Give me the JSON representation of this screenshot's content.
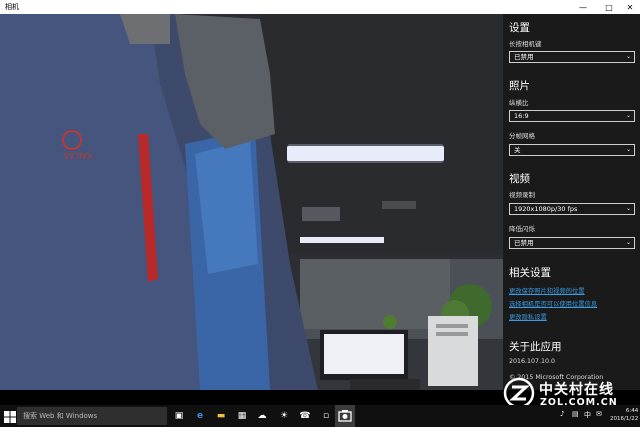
{
  "window": {
    "title": "相机",
    "min_icon": "minimize-icon",
    "max_icon": "maximize-icon",
    "close_icon": "close-icon"
  },
  "settings": {
    "heading": "设置",
    "shutter_label": "长按相机键",
    "shutter_value": "已禁用"
  },
  "photo": {
    "heading": "照片",
    "aspect_label": "纵横比",
    "aspect_value": "16:9",
    "grid_label": "分帧网格",
    "grid_value": "关"
  },
  "video": {
    "heading": "视频",
    "record_label": "视频录制",
    "record_value": "1920x1080p/30 fps",
    "flicker_label": "降低闪烁",
    "flicker_value": "已禁用"
  },
  "related": {
    "heading": "相关设置",
    "link1": "更改保存照片和视频的位置",
    "link2": "选择相机是否可以使用位置信息",
    "link3": "更改隐私设置"
  },
  "about": {
    "heading": "关于此应用",
    "version": "2016.107.10.0",
    "copyright": "© 2015 Microsoft Corporation"
  },
  "taskbar": {
    "search_placeholder": "搜索 Web 和 Windows",
    "time": "6:44",
    "date": "2016/1/22"
  },
  "watermark": {
    "cn": "中关村在线",
    "en": "ZOL.COM.CN"
  },
  "colors": {
    "link": "#3b9be0",
    "pane_bg": "#1a1a1a",
    "taskbar_bg": "#101010"
  }
}
